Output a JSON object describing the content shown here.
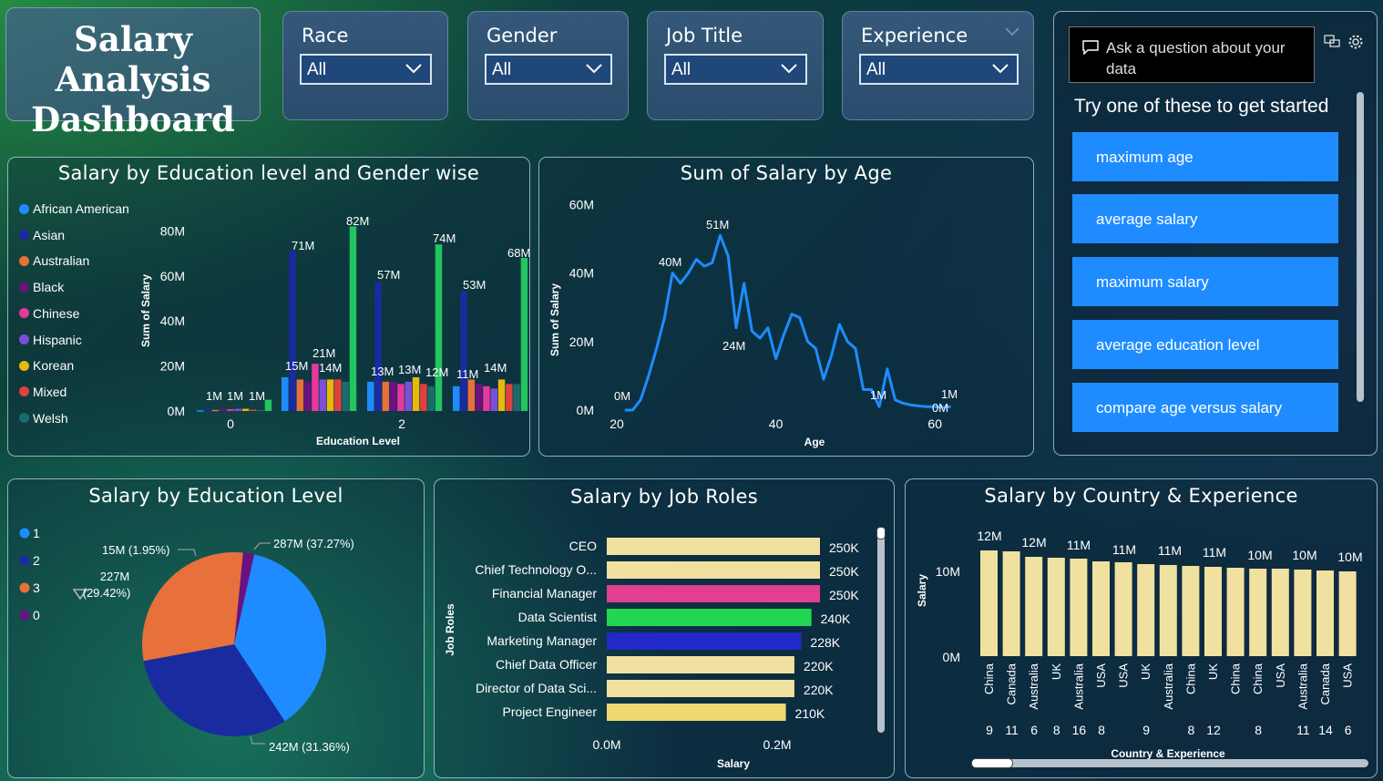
{
  "dashboard_title_line1": "Salary Analysis",
  "dashboard_title_line2": "Dashboard",
  "filters": [
    {
      "label": "Race",
      "value": "All"
    },
    {
      "label": "Gender",
      "value": "All"
    },
    {
      "label": "Job Title",
      "value": "All"
    },
    {
      "label": "Experience",
      "value": "All"
    }
  ],
  "qa": {
    "placeholder": "Ask a question about your data",
    "prompt": "Try one of these to get started",
    "suggestions": [
      "maximum age",
      "average salary",
      "maximum salary",
      "average education level",
      "compare age versus salary"
    ]
  },
  "edu_gender_chart": {
    "title": "Salary by Education level and Gender wise",
    "ylabel": "Sum of Salary",
    "xlabel": "Education Level",
    "legend": [
      {
        "name": "African American",
        "color": "#1e8cff"
      },
      {
        "name": "Asian",
        "color": "#1a2ba0"
      },
      {
        "name": "Australian",
        "color": "#e8703a"
      },
      {
        "name": "Black",
        "color": "#6a1280"
      },
      {
        "name": "Chinese",
        "color": "#e6399b"
      },
      {
        "name": "Hispanic",
        "color": "#7b4fd6"
      },
      {
        "name": "Korean",
        "color": "#e8b90c"
      },
      {
        "name": "Mixed",
        "color": "#e0413e"
      },
      {
        "name": "Welsh",
        "color": "#1a6b6b"
      }
    ],
    "yticks": [
      "80M",
      "60M",
      "40M",
      "20M",
      "0M"
    ],
    "xticks": [
      "0",
      "2"
    ]
  },
  "age_chart": {
    "title": "Sum of Salary by Age",
    "ylabel": "Sum of Salary",
    "xlabel": "Age",
    "yticks": [
      "60M",
      "40M",
      "20M",
      "0M"
    ],
    "xticks": [
      "20",
      "40",
      "60"
    ],
    "labels": [
      "0M",
      "40M",
      "51M",
      "24M",
      "1M",
      "1M",
      "0M"
    ]
  },
  "edu_pie": {
    "title": "Salary by Education Level",
    "legend": [
      {
        "name": "1",
        "color": "#1e8cff"
      },
      {
        "name": "2",
        "color": "#1a2ba0"
      },
      {
        "name": "3",
        "color": "#e8703a"
      },
      {
        "name": "0",
        "color": "#6a1280"
      }
    ],
    "labels": {
      "l1": "287M (37.27%)",
      "l2": "242M (31.36%)",
      "l3a": "227M",
      "l3b": "(29.42%)",
      "l0": "15M (1.95%)"
    }
  },
  "job_chart": {
    "title": "Salary by Job Roles",
    "ylabel": "Job Roles",
    "xlabel": "Salary",
    "xticks": [
      "0.0M",
      "0.2M"
    ]
  },
  "country_chart": {
    "title": "Salary by Country & Experience",
    "ylabel": "Salary",
    "xlabel": "Country & Experience",
    "yticks": [
      "10M",
      "0M"
    ]
  },
  "chart_data": [
    {
      "type": "bar",
      "title": "Salary by Education level and Gender wise",
      "xlabel": "Education Level",
      "ylabel": "Sum of Salary",
      "x": [
        0,
        1,
        2,
        3
      ],
      "series": [
        {
          "name": "African American",
          "values": [
            0.3,
            15,
            13,
            11
          ]
        },
        {
          "name": "Asian",
          "values": [
            1,
            71,
            57,
            53
          ]
        },
        {
          "name": "Australian",
          "values": [
            0.5,
            14,
            13,
            14
          ]
        },
        {
          "name": "Black",
          "values": [
            1,
            13,
            13,
            12
          ]
        },
        {
          "name": "Chinese",
          "values": [
            0.8,
            21,
            12,
            11
          ]
        },
        {
          "name": "Hispanic",
          "values": [
            1,
            14,
            13,
            10
          ]
        },
        {
          "name": "Korean",
          "values": [
            1,
            14,
            15,
            14
          ]
        },
        {
          "name": "Mixed",
          "values": [
            0.6,
            14,
            12,
            12
          ]
        },
        {
          "name": "Welsh",
          "values": [
            0.5,
            13,
            11,
            12
          ]
        },
        {
          "name": "",
          "values": [
            5,
            82,
            74,
            68
          ]
        }
      ],
      "data_labels": [
        "1M",
        "1M",
        "1M",
        "71M",
        "15M",
        "21M",
        "14M",
        "82M",
        "57M",
        "13M",
        "13M",
        "12M",
        "74M",
        "53M",
        "11M",
        "14M",
        "68M"
      ],
      "ylim": [
        0,
        90
      ]
    },
    {
      "type": "line",
      "title": "Sum of Salary by Age",
      "xlabel": "Age",
      "ylabel": "Sum of Salary",
      "x": [
        21,
        22,
        23,
        24,
        25,
        26,
        27,
        28,
        29,
        30,
        31,
        32,
        33,
        34,
        35,
        36,
        37,
        38,
        39,
        40,
        41,
        42,
        43,
        44,
        45,
        46,
        47,
        48,
        49,
        50,
        51,
        52,
        53,
        54,
        55,
        56,
        57,
        58,
        59,
        60,
        61,
        62
      ],
      "y": [
        0,
        0,
        3,
        10,
        18,
        27,
        40,
        37,
        40,
        44,
        42,
        43,
        51,
        45,
        24,
        37,
        23,
        21,
        24,
        15,
        22,
        28,
        27,
        20,
        18,
        9,
        16,
        25,
        20,
        18,
        6,
        6,
        1,
        12,
        3,
        2,
        1.5,
        1.2,
        1,
        1,
        0.8,
        1
      ],
      "ylim": [
        0,
        60
      ],
      "xlim": [
        20,
        62
      ]
    },
    {
      "type": "pie",
      "title": "Salary by Education Level",
      "labels": [
        "1",
        "2",
        "3",
        "0"
      ],
      "values": [
        287,
        242,
        227,
        15
      ],
      "percent": [
        37.27,
        31.36,
        29.42,
        1.95
      ]
    },
    {
      "type": "bar",
      "title": "Salary by Job Roles",
      "xlabel": "Salary",
      "ylabel": "Job Roles",
      "categories": [
        "CEO",
        "Chief Technology O...",
        "Financial Manager",
        "Data Scientist",
        "Marketing Manager",
        "Chief Data Officer",
        "Director of Data Sci...",
        "Project Engineer"
      ],
      "values": [
        250000,
        250000,
        250000,
        240000,
        228000,
        220000,
        220000,
        210000
      ],
      "value_labels": [
        "250K",
        "250K",
        "250K",
        "240K",
        "228K",
        "220K",
        "220K",
        "210K"
      ],
      "colors": [
        "#f0e1a0",
        "#f0e1a0",
        "#e0408f",
        "#22d654",
        "#2229c8",
        "#f0e1a0",
        "#f0e1a0",
        "#f0d870"
      ]
    },
    {
      "type": "bar",
      "title": "Salary by Country & Experience",
      "xlabel": "Country & Experience",
      "ylabel": "Salary",
      "categories": [
        "China",
        "Canada",
        "Australia",
        "UK",
        "Australia",
        "USA",
        "USA",
        "UK",
        "Australia",
        "China",
        "UK",
        "China",
        "China",
        "USA",
        "Australia",
        "Canada",
        "USA"
      ],
      "experience_labels": [
        "9",
        "11",
        "6",
        "8",
        "16",
        "8",
        "",
        "9",
        "",
        "8",
        "12",
        "",
        "8",
        "",
        "11",
        "14",
        "6"
      ],
      "values": [
        12,
        12,
        11,
        11,
        11,
        11,
        11,
        11,
        11,
        11,
        11,
        11,
        10,
        10,
        10,
        10,
        10
      ],
      "value_labels": [
        "12M",
        "12M",
        "11M",
        "",
        "11M",
        "",
        "11M",
        "",
        "11M",
        "",
        "11M",
        "",
        "10M",
        "",
        "10M",
        "",
        "10M"
      ]
    }
  ]
}
